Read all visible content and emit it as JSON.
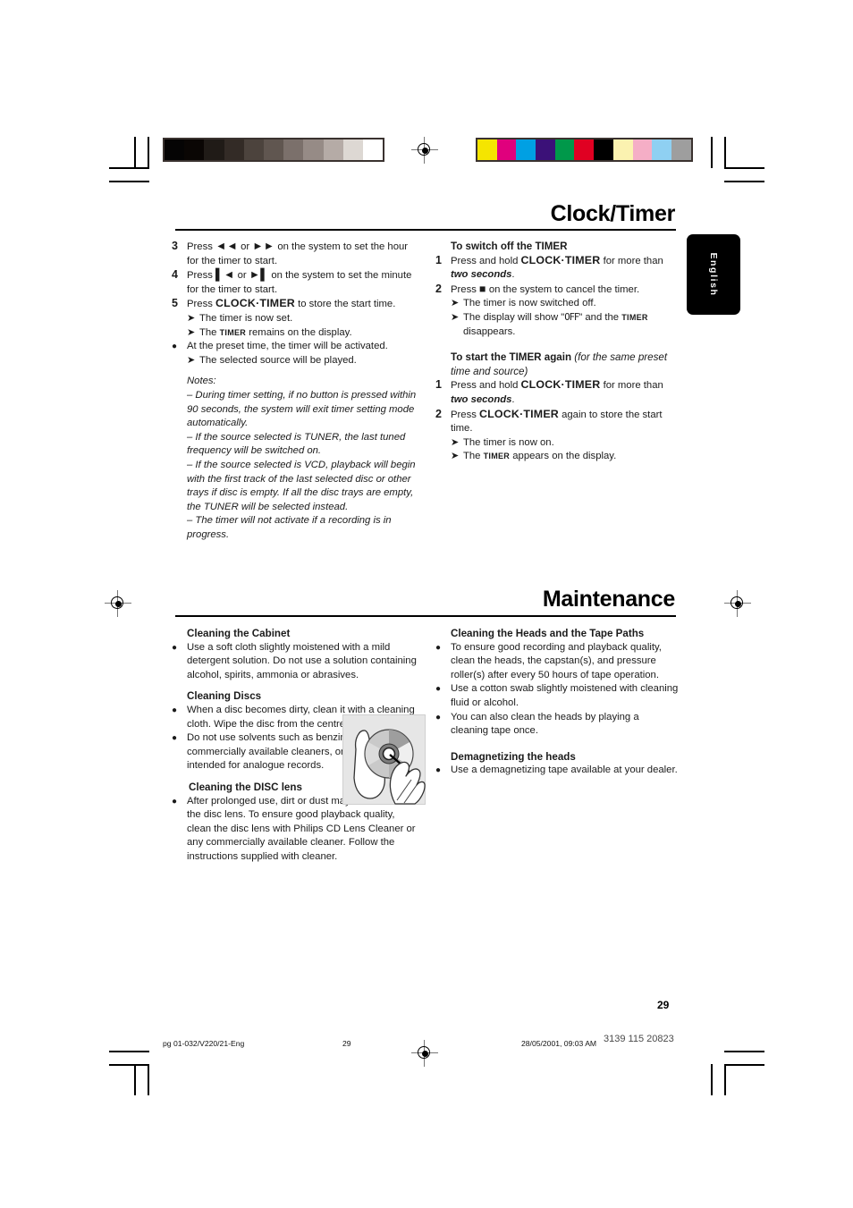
{
  "page": {
    "number": "29",
    "language_tab": "English"
  },
  "marks": {
    "grayscale_swatches": [
      "#050404",
      "#0a0604",
      "#201b17",
      "#332b26",
      "#4c433d",
      "#605650",
      "#7b706b",
      "#968b86",
      "#b5aba6",
      "#ddd8d3",
      "#ffffff"
    ],
    "color_swatches": [
      "#f5e500",
      "#e0007d",
      "#00a0e3",
      "#3b1178",
      "#00984a",
      "#e00022",
      "#000000",
      "#fbf2b0",
      "#f5aec6",
      "#8fd0f2",
      "#9e9e9e"
    ]
  },
  "sections": [
    {
      "id": "clock-timer",
      "title": "Clock/Timer",
      "left_column": {
        "steps": [
          {
            "marker": "3",
            "html": "Press <b class=\"kw\">&#9668;&#9668;</b> or <b class=\"kw\">&#9658;&#9658;</b> on the system to set the hour for the timer to start."
          },
          {
            "marker": "4",
            "html": "Press <b class=\"kw\">&#9612;&#9668;</b> or <b class=\"kw\">&#9658;&#9612;</b> on the system to set the minute for the timer to start."
          },
          {
            "marker": "5",
            "html": "Press <b class=\"kw\">CLOCK&#183;TIMER</b> to store the start time."
          }
        ],
        "results_after_step5": [
          "The timer is now set.",
          "The <span class=\"sc\">TIMER</span> remains on the display."
        ],
        "bullet": "At the preset time, the timer will be activated.",
        "bullet_result": "The selected source will be played.",
        "notes_label": "Notes:",
        "notes": [
          "–  During timer setting, if no button is pressed within 90 seconds, the system will exit timer setting mode automatically.",
          "–  If the source selected is TUNER, the last tuned frequency will be switched on.",
          "–  If the source selected is VCD, playback will begin with the first track of the last selected disc or other trays if disc is empty. If all the disc trays are empty, the TUNER will be selected instead.",
          "–  The timer will not activate if a recording is in progress."
        ]
      },
      "right_column": {
        "block1": {
          "heading": "To switch off the TIMER",
          "steps": [
            {
              "marker": "1",
              "html": "Press and hold <b class=\"kw\">CLOCK&#183;TIMER</b> for more than <b><i>two seconds</i></b>."
            },
            {
              "marker": "2",
              "html": "Press <b class=\"kw\">&#9632;</b> on the system to cancel the timer."
            }
          ],
          "results": [
            "The timer is now switched off.",
            "The display will show \"<span class=\"lcd\">OFF</span>\" and the <span class=\"sc\">TIMER</span> disappears."
          ]
        },
        "block2": {
          "heading_bold": "To start the TIMER again",
          "heading_italic": "(for the same preset time and source)",
          "steps": [
            {
              "marker": "1",
              "html": "Press and hold <b class=\"kw\">CLOCK&#183;TIMER</b> for more than <b><i>two seconds</i></b>."
            },
            {
              "marker": "2",
              "html": "Press <b class=\"kw\">CLOCK&#183;TIMER</b> again to store the start time."
            }
          ],
          "results": [
            "The timer is now on.",
            "The <span class=\"sc\">TIMER</span> appears on the display."
          ]
        }
      }
    },
    {
      "id": "maintenance",
      "title": "Maintenance",
      "left_column": {
        "groups": [
          {
            "heading": "Cleaning the Cabinet",
            "bullets": [
              "Use a soft cloth slightly moistened with a mild detergent solution. Do not use a solution containing alcohol, spirits, ammonia or abrasives."
            ]
          },
          {
            "heading": "Cleaning Discs",
            "bullets": [
              "When a disc becomes dirty, clean it with a cleaning cloth. Wipe the disc from the centre out.",
              "Do not use solvents such as benzine, thinner, commercially available cleaners, or antistatic spray intended for analogue records."
            ]
          },
          {
            "heading": "Cleaning the DISC lens",
            "bullets": [
              "After prolonged use, dirt or dust may accumulate at the disc lens. To ensure good playback quality, clean the disc lens with Philips CD Lens Cleaner or any commercially available cleaner. Follow the instructions supplied with cleaner."
            ]
          }
        ],
        "figure_alt": "disc-cleaning-illustration"
      },
      "right_column": {
        "groups": [
          {
            "heading": "Cleaning the Heads and the Tape Paths",
            "bullets": [
              "To ensure good recording and playback quality, clean the heads, the capstan(s), and pressure roller(s) after every 50 hours of tape operation.",
              "Use a cotton swab slightly moistened with cleaning fluid or alcohol.",
              "You can also clean the heads by playing a cleaning tape once."
            ]
          },
          {
            "heading": "Demagnetizing the heads",
            "bullets": [
              "Use a demagnetizing tape available at your dealer."
            ]
          }
        ]
      }
    }
  ],
  "footer": {
    "file_label": "pg 01-032/V220/21-Eng",
    "page_mark": "29",
    "timestamp": "28/05/2001, 09:03 AM",
    "doc_code": "3139 115 20823"
  }
}
